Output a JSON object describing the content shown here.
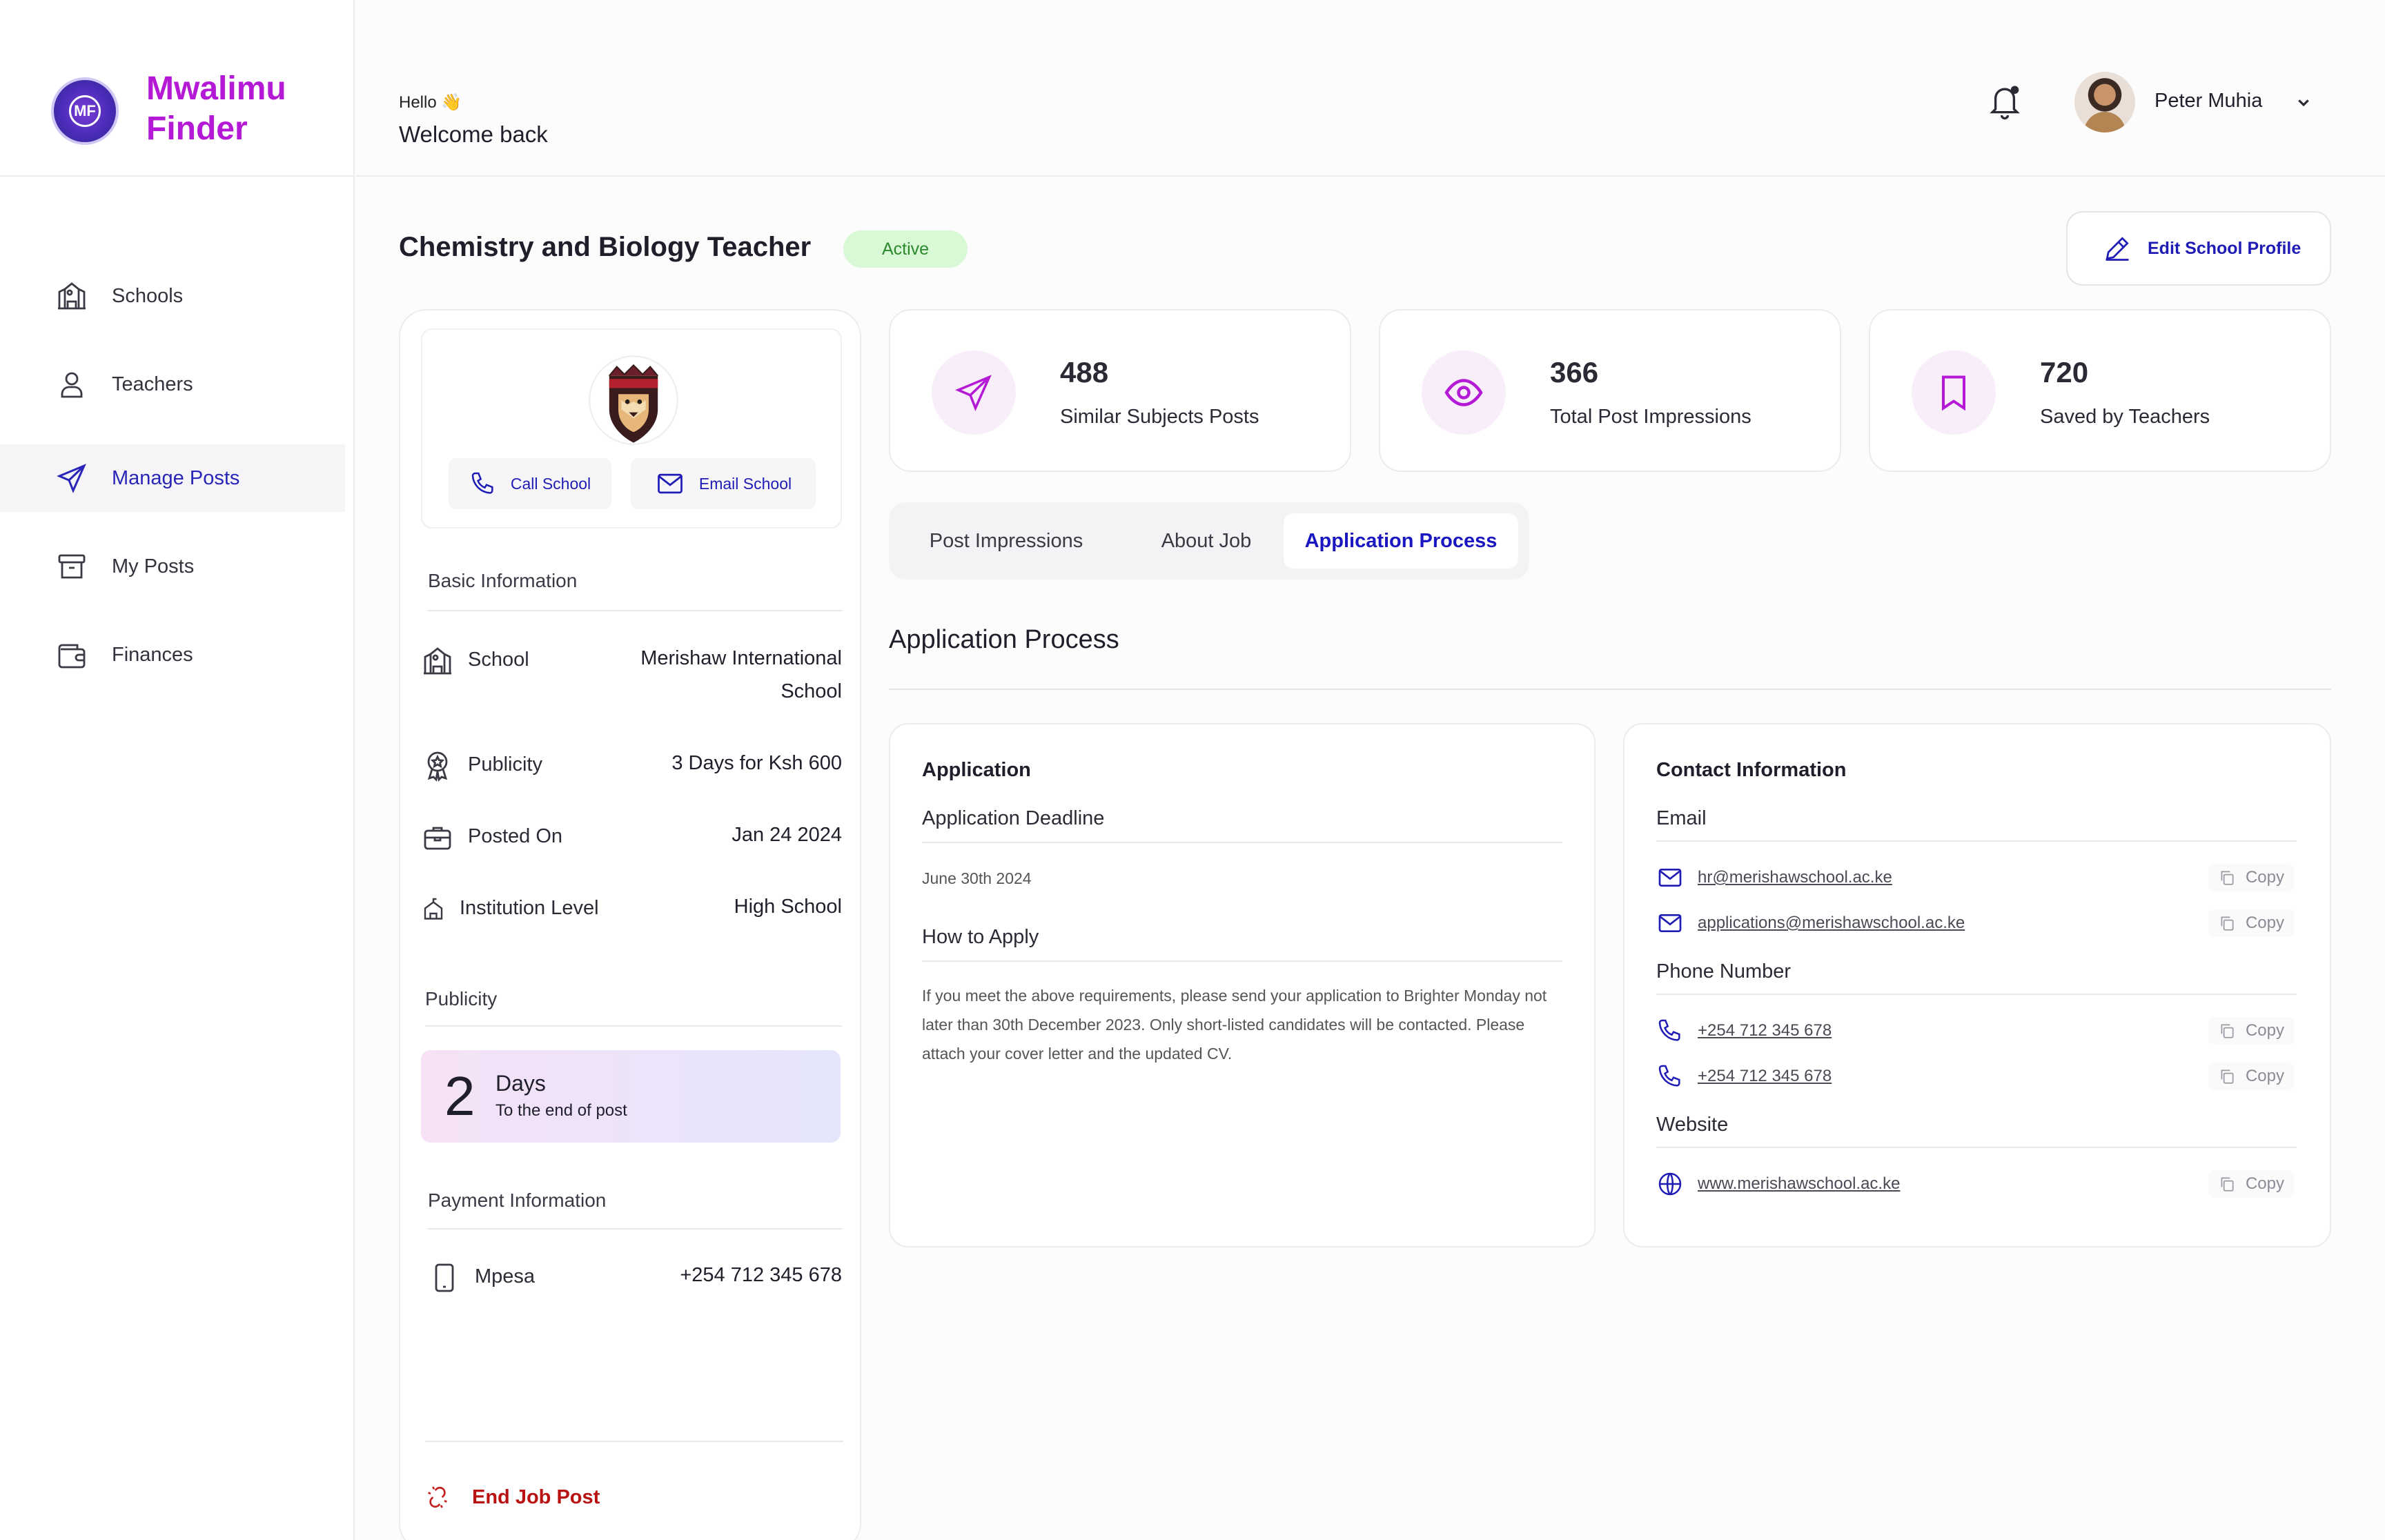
{
  "brand": {
    "name": "Mwalimu Finder",
    "logo_initials": "MF"
  },
  "sidebar": {
    "items": [
      {
        "label": "Schools",
        "icon": "school-icon"
      },
      {
        "label": "Teachers",
        "icon": "user-icon"
      },
      {
        "label": "Manage Posts",
        "icon": "send-icon",
        "active": true
      },
      {
        "label": "My Posts",
        "icon": "archive-icon"
      },
      {
        "label": "Finances",
        "icon": "wallet-icon"
      }
    ]
  },
  "header": {
    "greeting": "Hello 👋",
    "welcome": "Welcome back",
    "user_name": "Peter Muhia"
  },
  "post": {
    "title": "Chemistry and Biology Teacher",
    "status": "Active",
    "edit_label": "Edit School Profile"
  },
  "school_card": {
    "call_label": "Call School",
    "email_label": "Email School",
    "basic_info_title": "Basic Information",
    "rows": [
      {
        "label": "School",
        "value": "Merishaw International School"
      },
      {
        "label": "Publicity",
        "value": "3 Days for Ksh 600"
      },
      {
        "label": "Posted On",
        "value": "Jan 24 2024"
      },
      {
        "label": "Institution Level",
        "value": "High School"
      }
    ],
    "publicity_title": "Publicity",
    "days_left": "2",
    "days_unit": "Days",
    "days_caption": "To the end of post",
    "payment_title": "Payment Information",
    "payment_method": "Mpesa",
    "payment_number": "+254 712 345 678",
    "end_label": "End Job Post"
  },
  "stats": [
    {
      "value": "488",
      "label": "Similar Subjects Posts",
      "icon": "send-icon"
    },
    {
      "value": "366",
      "label": "Total Post Impressions",
      "icon": "eye-icon"
    },
    {
      "value": "720",
      "label": "Saved by Teachers",
      "icon": "bookmark-icon"
    }
  ],
  "tabs": [
    {
      "label": "Post Impressions"
    },
    {
      "label": "About Job"
    },
    {
      "label": "Application Process",
      "active": true
    }
  ],
  "section_title": "Application Process",
  "application": {
    "title": "Application",
    "deadline_label": "Application Deadline",
    "deadline_value": "June 30th 2024",
    "how_label": "How to Apply",
    "how_text": "If you meet the above requirements, please send your application to Brighter Monday not later than 30th December 2023. Only short-listed candidates will be contacted. Please attach your cover letter and the updated CV."
  },
  "contact": {
    "title": "Contact Information",
    "email_label": "Email",
    "emails": [
      "hr@merishawschool.ac.ke",
      "applications@merishawschool.ac.ke"
    ],
    "phone_label": "Phone Number",
    "phones": [
      "+254 712 345 678",
      "+254 712 345 678"
    ],
    "website_label": "Website",
    "website": "www.merishawschool.ac.ke",
    "copy_label": "Copy"
  },
  "colors": {
    "brand": "#b41ad6",
    "accent": "#1f1bb5",
    "active_badge": "#d8f8d6",
    "danger": "#b81212"
  }
}
